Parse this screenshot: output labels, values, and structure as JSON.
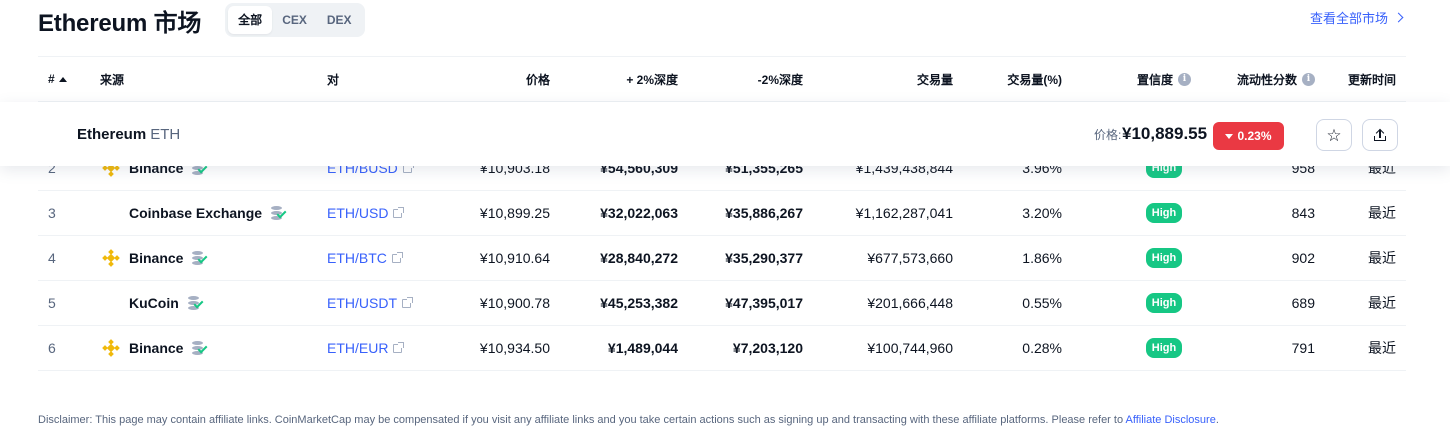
{
  "header": {
    "title": "Ethereum 市场",
    "tabs": [
      {
        "label": "全部",
        "active": true
      },
      {
        "label": "CEX",
        "active": false
      },
      {
        "label": "DEX",
        "active": false
      }
    ],
    "view_all": "查看全部市场"
  },
  "table": {
    "columns": {
      "num": "#",
      "source": "来源",
      "pair": "对",
      "price": "价格",
      "depth_plus": "+ 2%深度",
      "depth_minus": "-2%深度",
      "volume": "交易量",
      "volume_pct": "交易量(%)",
      "confidence": "置信度",
      "liquidity": "流动性分数",
      "updated": "更新时间"
    },
    "info_glyph": "i",
    "rows": [
      {
        "num": "2",
        "source": "Binance",
        "logo": "binance",
        "pair": "ETH/BUSD",
        "price": "¥10,903.18",
        "depth_plus": "¥54,560,309",
        "depth_minus": "¥51,355,265",
        "volume": "¥1,439,438,844",
        "volume_pct": "3.96%",
        "confidence": "High",
        "liquidity": "958",
        "updated": "最近"
      },
      {
        "num": "3",
        "source": "Coinbase Exchange",
        "logo": "none",
        "pair": "ETH/USD",
        "price": "¥10,899.25",
        "depth_plus": "¥32,022,063",
        "depth_minus": "¥35,886,267",
        "volume": "¥1,162,287,041",
        "volume_pct": "3.20%",
        "confidence": "High",
        "liquidity": "843",
        "updated": "最近"
      },
      {
        "num": "4",
        "source": "Binance",
        "logo": "binance",
        "pair": "ETH/BTC",
        "price": "¥10,910.64",
        "depth_plus": "¥28,840,272",
        "depth_minus": "¥35,290,377",
        "volume": "¥677,573,660",
        "volume_pct": "1.86%",
        "confidence": "High",
        "liquidity": "902",
        "updated": "最近"
      },
      {
        "num": "5",
        "source": "KuCoin",
        "logo": "none",
        "pair": "ETH/USDT",
        "price": "¥10,900.78",
        "depth_plus": "¥45,253,382",
        "depth_minus": "¥47,395,017",
        "volume": "¥201,666,448",
        "volume_pct": "0.55%",
        "confidence": "High",
        "liquidity": "689",
        "updated": "最近"
      },
      {
        "num": "6",
        "source": "Binance",
        "logo": "binance",
        "pair": "ETH/EUR",
        "price": "¥10,934.50",
        "depth_plus": "¥1,489,044",
        "depth_minus": "¥7,203,120",
        "volume": "¥100,744,960",
        "volume_pct": "0.28%",
        "confidence": "High",
        "liquidity": "791",
        "updated": "最近"
      }
    ]
  },
  "sticky": {
    "name": "Ethereum",
    "symbol": "ETH",
    "price_label": "价格:",
    "price": "¥10,889.55",
    "change": "0.23%",
    "change_direction": "down",
    "star_glyph": "☆"
  },
  "disclaimer": {
    "text": "Disclaimer: This page may contain affiliate links. CoinMarketCap may be compensated if you visit any affiliate links and you take certain actions such as signing up and transacting with these affiliate platforms. Please refer to ",
    "link": "Affiliate Disclosure",
    "end": "."
  },
  "colors": {
    "accent": "#3861fb",
    "positive": "#16c784",
    "negative": "#ea3943",
    "binance": "#f0b90b"
  }
}
